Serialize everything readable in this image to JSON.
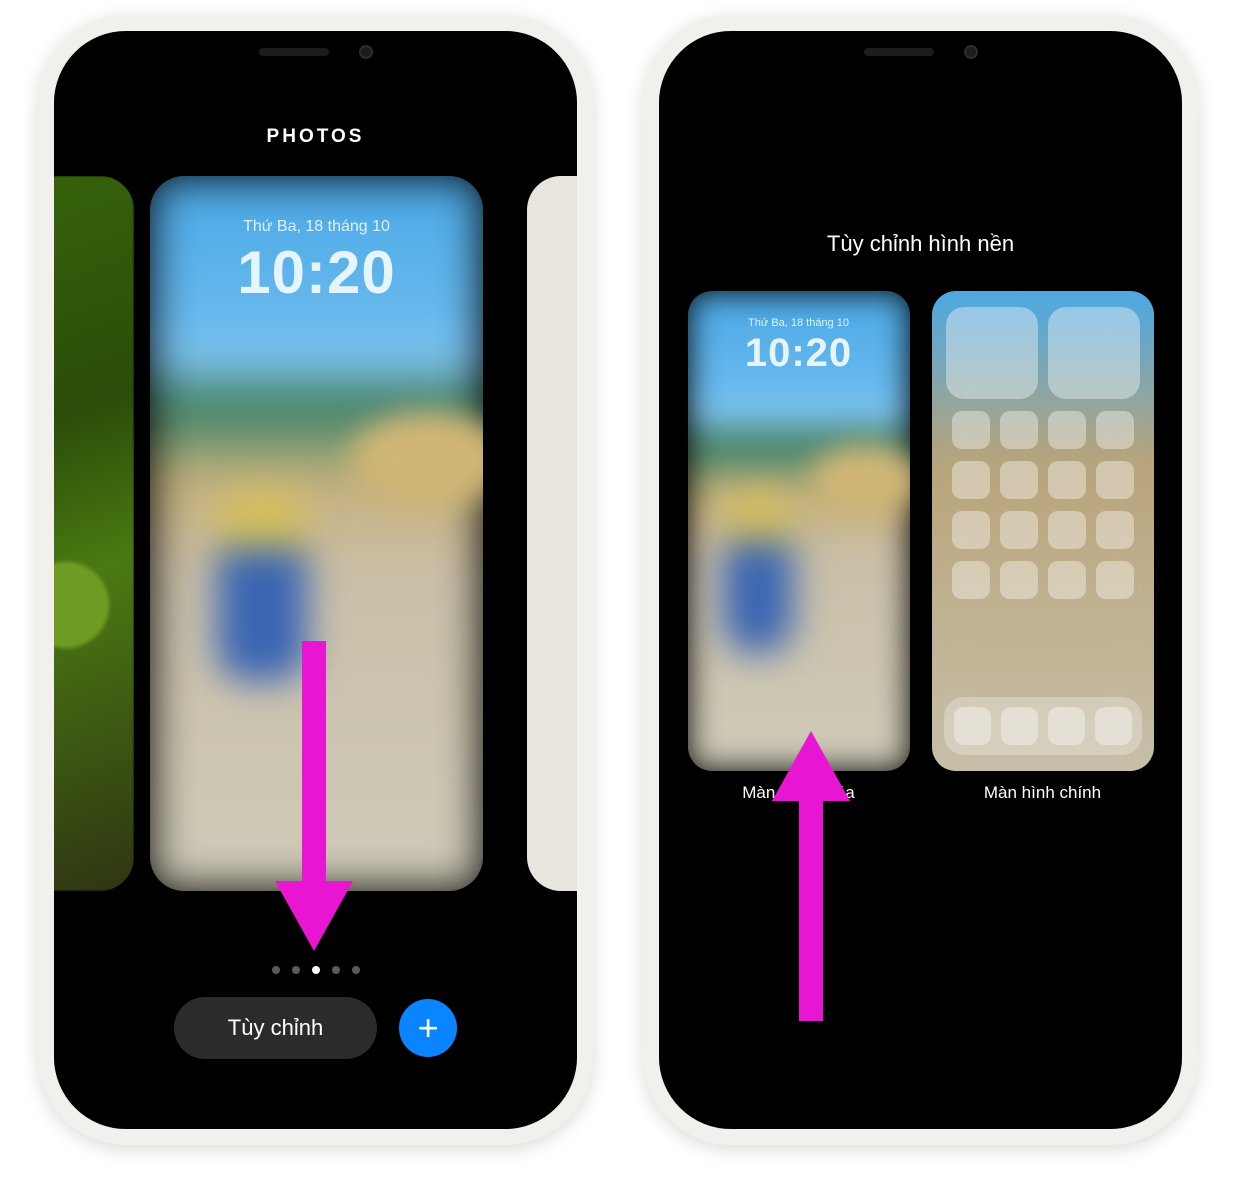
{
  "left": {
    "header": "PHOTOS",
    "lock_preview": {
      "date": "Thứ Ba, 18 tháng 10",
      "time": "10:20"
    },
    "pager": {
      "count": 5,
      "active": 2
    },
    "customize_button": "Tùy chỉnh",
    "add_button_symbol": "+"
  },
  "right": {
    "title": "Tùy chỉnh hình nền",
    "lock_preview": {
      "date": "Thứ Ba, 18 tháng 10",
      "time": "10:20"
    },
    "lock_label": "Màn hình khóa",
    "home_label": "Màn hình chính"
  },
  "annotation_color": "#e815d2"
}
